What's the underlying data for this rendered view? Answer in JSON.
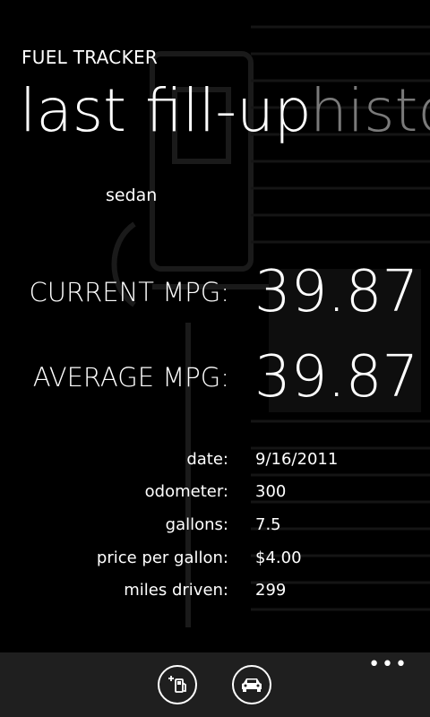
{
  "app": {
    "title": "FUEL TRACKER"
  },
  "pivot": {
    "items": [
      {
        "label": "last fill-up",
        "active": true
      },
      {
        "label": "history",
        "active": false
      }
    ]
  },
  "vehicle": {
    "name": "sedan"
  },
  "mpg": {
    "current_label": "CURRENT MPG:",
    "current_value": "39.87",
    "average_label": "AVERAGE MPG:",
    "average_value": "39.87"
  },
  "details": [
    {
      "label": "date:",
      "value": "9/16/2011"
    },
    {
      "label": "odometer:",
      "value": "300"
    },
    {
      "label": "gallons:",
      "value": "7.5"
    },
    {
      "label": "price per gallon:",
      "value": "$4.00"
    },
    {
      "label": "miles driven:",
      "value": "299"
    }
  ],
  "app_bar": {
    "buttons": [
      {
        "icon": "add-fillup-icon"
      },
      {
        "icon": "car-icon"
      }
    ],
    "more_icon": "ellipsis-icon"
  },
  "colors": {
    "background": "#000000",
    "foreground": "#ffffff",
    "inactive_pivot": "#7a7a7a",
    "app_bar": "#1f1f1f"
  }
}
